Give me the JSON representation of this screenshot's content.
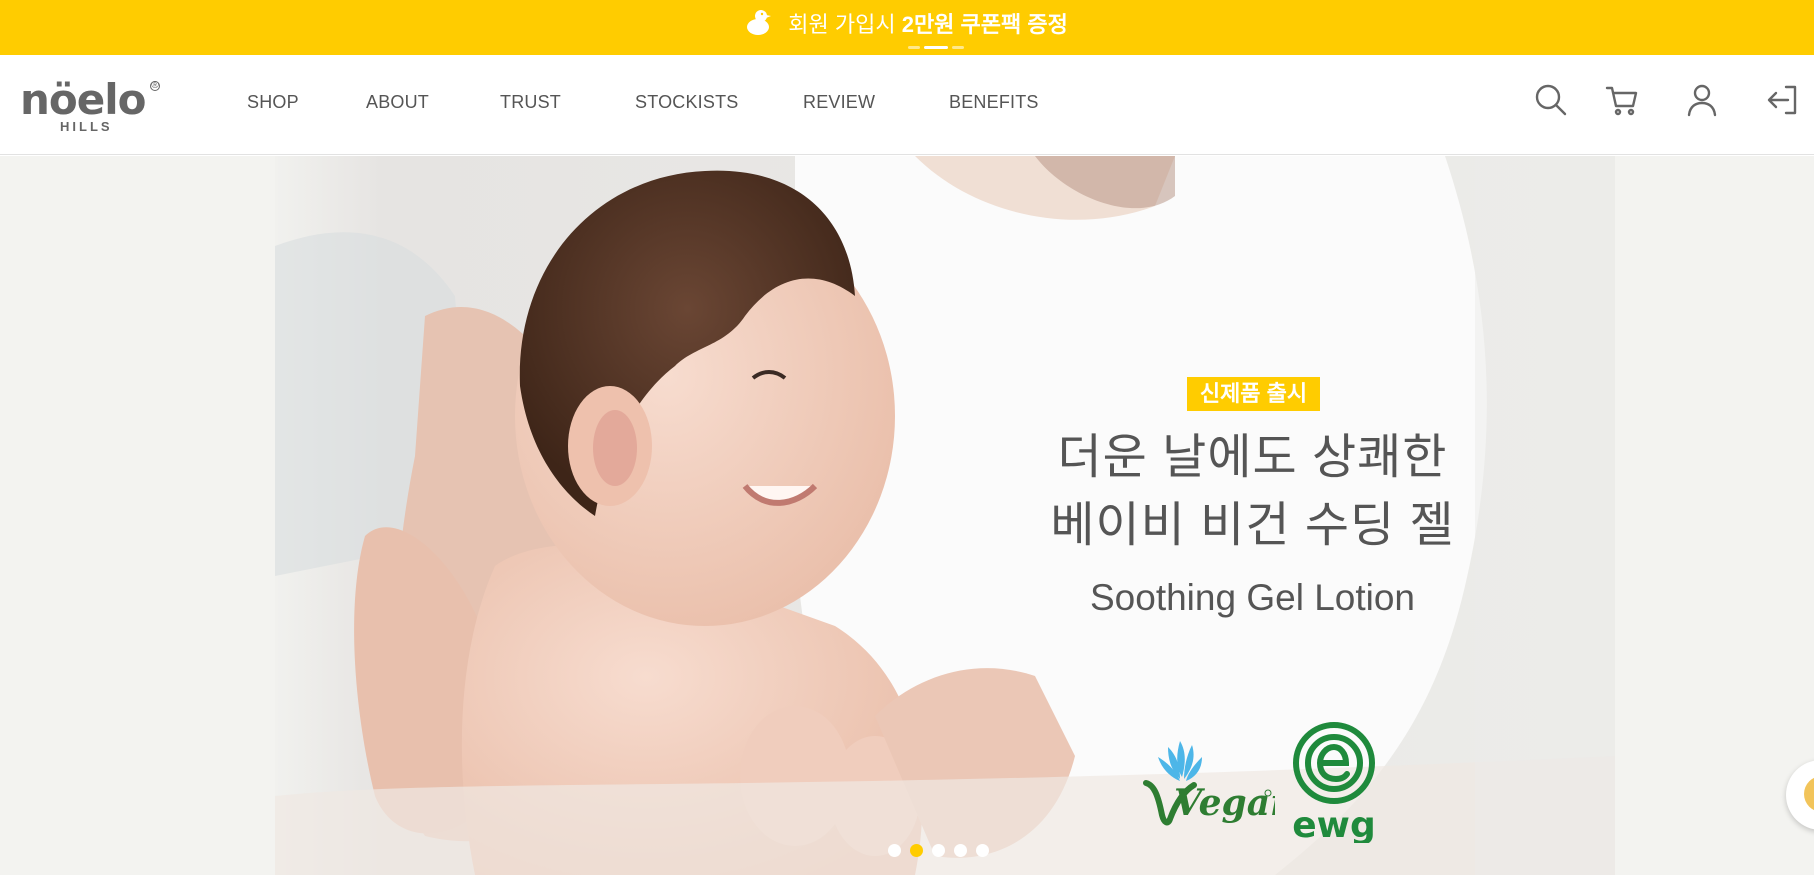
{
  "promo": {
    "text_regular": "회원 가입시 ",
    "text_bold": "2만원 쿠폰팩 증정",
    "icon": "duck-icon",
    "slides": 3,
    "active_slide": 2
  },
  "header": {
    "logo_text": "nöelo",
    "logo_sub": "HILLS",
    "logo_reg": "®",
    "nav": [
      {
        "label": "SHOP"
      },
      {
        "label": "ABOUT"
      },
      {
        "label": "TRUST"
      },
      {
        "label": "STOCKISTS"
      },
      {
        "label": "REVIEW"
      },
      {
        "label": "BENEFITS"
      }
    ],
    "icons": [
      "search-icon",
      "cart-icon",
      "user-icon",
      "logout-icon"
    ]
  },
  "hero": {
    "badge": "신제품 출시",
    "headline_line1": "더운 날에도 상쾌한",
    "headline_line2": "베이비 비건 수딩 젤",
    "subline": "Soothing Gel Lotion",
    "vegan_label": "Vegan",
    "ewg_label": "ewg",
    "dots": 5,
    "active_dot": 2
  },
  "colors": {
    "accent": "#ffcc00",
    "text": "#555555",
    "ewg_green": "#1f8a3c",
    "vegan_green": "#2e7d32",
    "vegan_blue": "#4db6e8"
  }
}
